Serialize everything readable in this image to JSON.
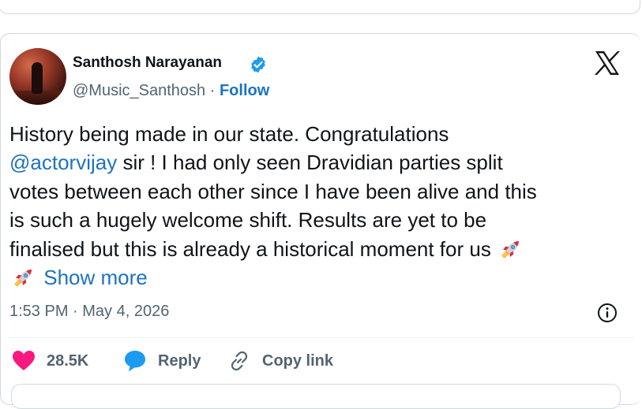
{
  "tweet": {
    "author_name": "Santhosh Narayanan",
    "handle": "@Music_Santhosh",
    "separator": "·",
    "follow_label": "Follow",
    "text_line1": "History being made in our state. Congratulations",
    "mention": "@actorvijay",
    "text_line2_rest": " sir ! I had only seen Dravidian parties split",
    "text_line3": "votes between each other since I have been alive and this",
    "text_line4": "is such a hugely welcome shift. Results are yet to be",
    "text_line5": "finalised but this is already a historical moment for us",
    "emoji_1": "rocket",
    "emoji_2": "rocket",
    "show_more_label": "Show more",
    "timestamp": "1:53 PM · May 4, 2026"
  },
  "actions": {
    "like_count": "28.5K",
    "reply_label": "Reply",
    "copy_link_label": "Copy link"
  },
  "icons": {
    "verified": "verified-badge-icon",
    "brand": "x-logo-icon",
    "info": "info-icon",
    "like": "heart-icon",
    "reply": "speech-bubble-icon",
    "copy": "link-icon"
  },
  "colors": {
    "accent_blue": "#1d72c2",
    "verified_blue": "#1d9bf0",
    "like_pink": "#f91880",
    "muted_text": "#536471",
    "text": "#0f1419",
    "border": "#cfd9de"
  }
}
